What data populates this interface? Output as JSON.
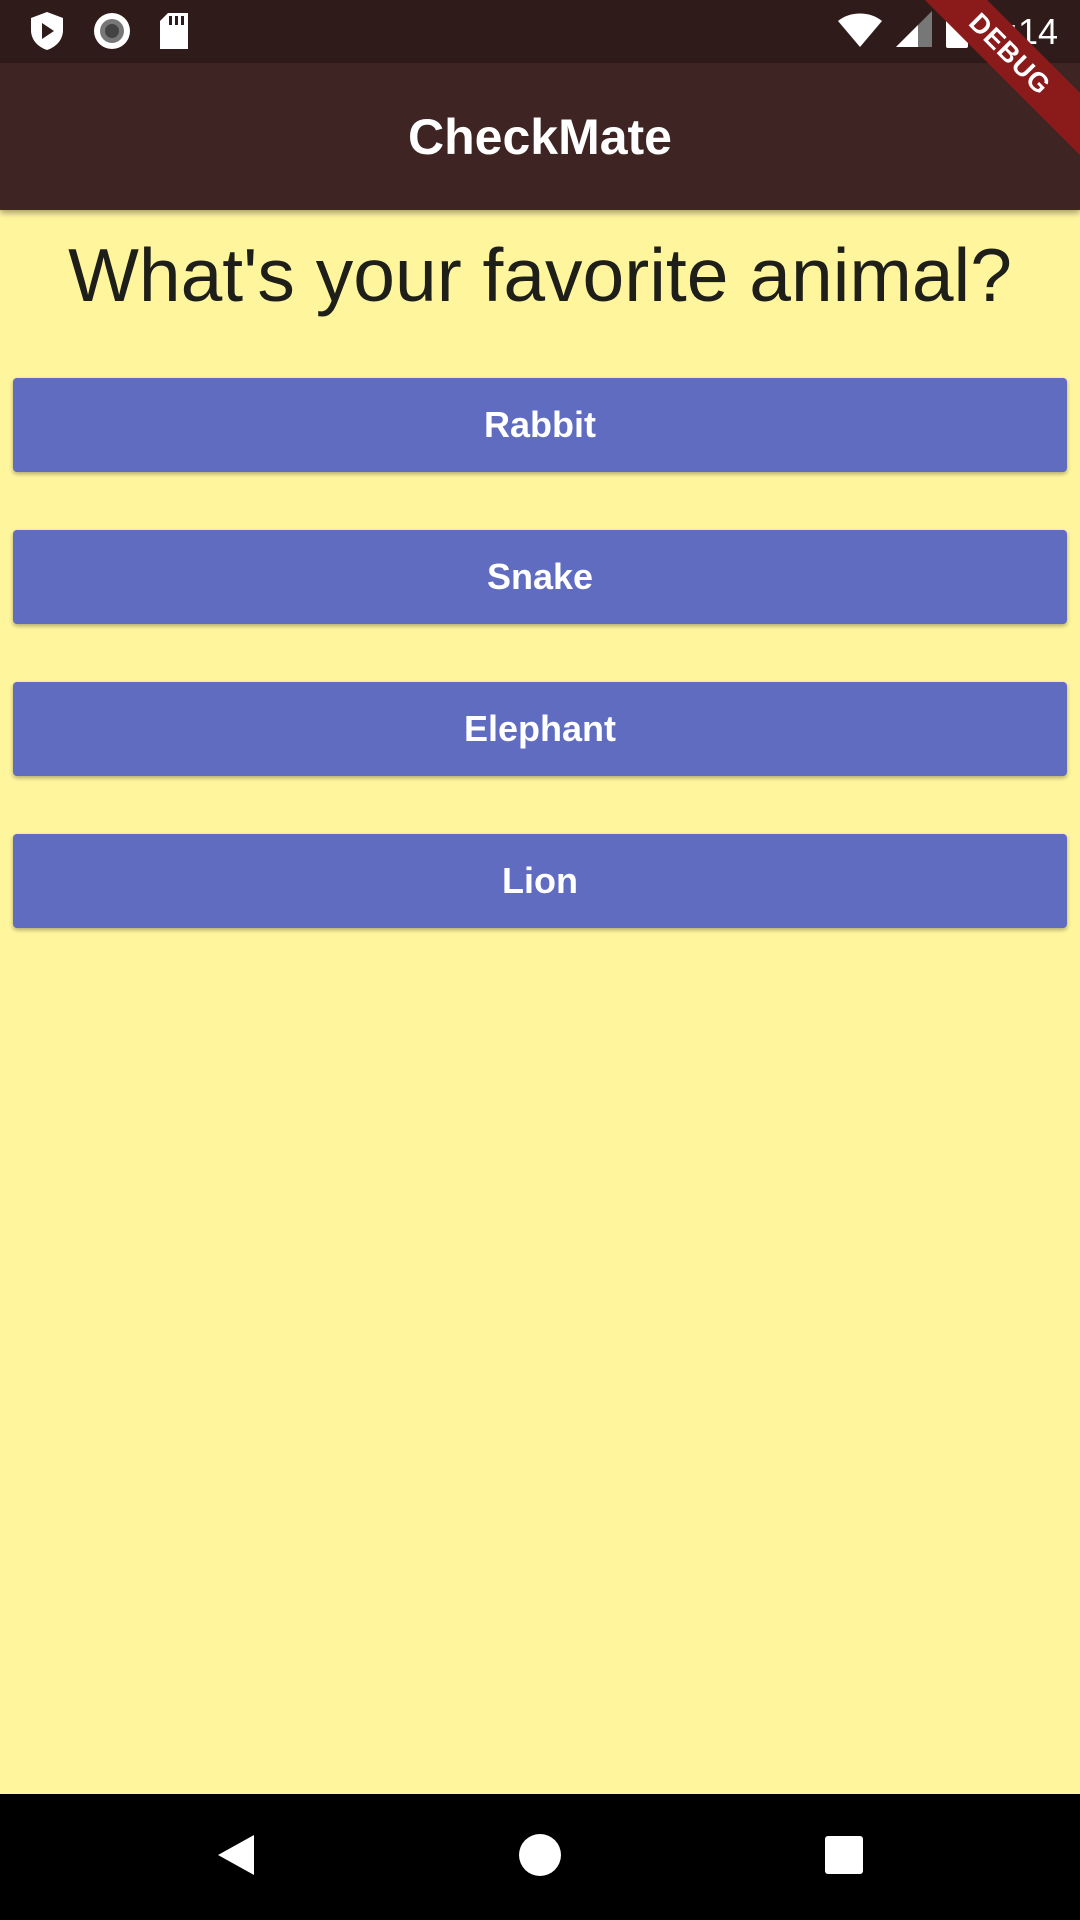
{
  "status_bar": {
    "time": "4:14",
    "icons_left": [
      "play-protect-icon",
      "record-icon",
      "sd-card-icon"
    ],
    "icons_right": [
      "wifi-icon",
      "signal-icon",
      "battery-icon"
    ]
  },
  "app_bar": {
    "title": "CheckMate"
  },
  "debug_banner": {
    "label": "DEBUG"
  },
  "question": {
    "text": "What's your favorite animal?"
  },
  "answers": [
    {
      "label": "Rabbit"
    },
    {
      "label": "Snake"
    },
    {
      "label": "Elephant"
    },
    {
      "label": "Lion"
    }
  ],
  "nav_bar": {
    "buttons": [
      "back-icon",
      "home-icon",
      "recents-icon"
    ]
  },
  "colors": {
    "background": "#fff59d",
    "app_bar": "#3e2523",
    "status_bar": "#2f1c1a",
    "button": "#5f6cc0",
    "debug_banner": "#8b1a1a"
  }
}
